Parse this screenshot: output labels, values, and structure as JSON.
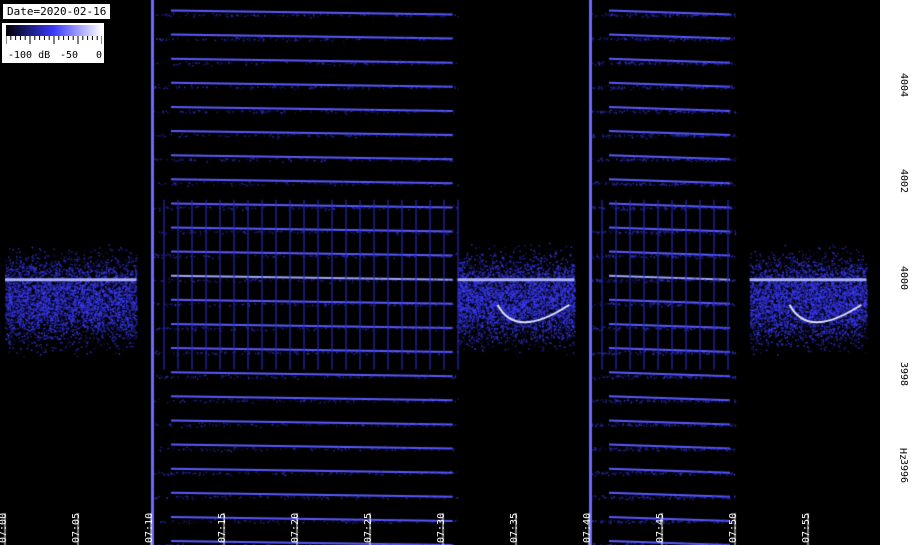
{
  "chart_data": {
    "type": "heatmap",
    "title": "",
    "date_label": "Date=2020-02-16",
    "colorbar": {
      "ticks": [
        "-100 dB",
        "-50",
        "0"
      ],
      "range": [
        -100,
        0
      ],
      "colors": [
        "#000000",
        "#3a3aff",
        "#ffffff"
      ]
    },
    "x_ticks": [
      "07:00",
      "07:05",
      "07:10",
      "07:15",
      "07:20",
      "07:25",
      "07:30",
      "07:35",
      "07:40",
      "07:45",
      "07:50",
      "07:55"
    ],
    "x_range": [
      "07:00",
      "07:59"
    ],
    "y_ticks": [
      "3996",
      "3998",
      "4000",
      "4002",
      "4004"
    ],
    "y_range": [
      3994.5,
      4005.8
    ],
    "y_unit": "Hz",
    "carrier_hz": 4000.0,
    "segments": [
      {
        "start": "07:00",
        "end": "07:09",
        "kind": "carrier"
      },
      {
        "start": "07:10",
        "end": "07:31",
        "kind": "harmonics"
      },
      {
        "start": "07:31",
        "end": "07:39",
        "kind": "carrier-drift"
      },
      {
        "start": "07:40",
        "end": "07:50",
        "kind": "harmonics"
      },
      {
        "start": "07:51",
        "end": "07:59",
        "kind": "carrier-drift"
      }
    ]
  }
}
